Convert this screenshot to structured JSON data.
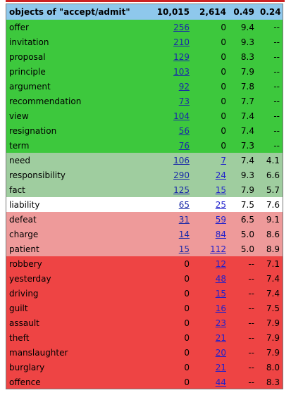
{
  "header": {
    "word": "objects of \"accept/admit\"",
    "col_a": "10,015",
    "col_b": "2,614",
    "col_c": "0.49",
    "col_d": "0.24"
  },
  "colors": {
    "header": "#8ec8ec",
    "green": "#3dc83d",
    "light_green": "#9fcd9f",
    "white": "#ffffff",
    "pink": "#ee9a9a",
    "red": "#ee4444",
    "link": "#1a2aa8",
    "top_strip": "#cc2222"
  },
  "rows": [
    {
      "word": "offer",
      "a": "256",
      "b": "0",
      "c": "9.4",
      "d": "--",
      "band": "green",
      "a_link": true,
      "b_link": false
    },
    {
      "word": "invitation",
      "a": "210",
      "b": "0",
      "c": "9.3",
      "d": "--",
      "band": "green",
      "a_link": true,
      "b_link": false
    },
    {
      "word": "proposal",
      "a": "129",
      "b": "0",
      "c": "8.3",
      "d": "--",
      "band": "green",
      "a_link": true,
      "b_link": false
    },
    {
      "word": "principle",
      "a": "103",
      "b": "0",
      "c": "7.9",
      "d": "--",
      "band": "green",
      "a_link": true,
      "b_link": false
    },
    {
      "word": "argument",
      "a": "92",
      "b": "0",
      "c": "7.8",
      "d": "--",
      "band": "green",
      "a_link": true,
      "b_link": false
    },
    {
      "word": "recommendation",
      "a": "73",
      "b": "0",
      "c": "7.7",
      "d": "--",
      "band": "green",
      "a_link": true,
      "b_link": false
    },
    {
      "word": "view",
      "a": "104",
      "b": "0",
      "c": "7.4",
      "d": "--",
      "band": "green",
      "a_link": true,
      "b_link": false
    },
    {
      "word": "resignation",
      "a": "56",
      "b": "0",
      "c": "7.4",
      "d": "--",
      "band": "green",
      "a_link": true,
      "b_link": false
    },
    {
      "word": "term",
      "a": "76",
      "b": "0",
      "c": "7.3",
      "d": "--",
      "band": "green",
      "a_link": true,
      "b_link": false
    },
    {
      "word": "need",
      "a": "106",
      "b": "7",
      "c": "7.4",
      "d": "4.1",
      "band": "light",
      "a_link": true,
      "b_link": true
    },
    {
      "word": "responsibility",
      "a": "290",
      "b": "24",
      "c": "9.3",
      "d": "6.6",
      "band": "light",
      "a_link": true,
      "b_link": true
    },
    {
      "word": "fact",
      "a": "125",
      "b": "15",
      "c": "7.9",
      "d": "5.7",
      "band": "light",
      "a_link": true,
      "b_link": true
    },
    {
      "word": "liability",
      "a": "65",
      "b": "25",
      "c": "7.5",
      "d": "7.6",
      "band": "white",
      "a_link": true,
      "b_link": true
    },
    {
      "word": "defeat",
      "a": "31",
      "b": "59",
      "c": "6.5",
      "d": "9.1",
      "band": "pink",
      "a_link": true,
      "b_link": true
    },
    {
      "word": "charge",
      "a": "14",
      "b": "84",
      "c": "5.0",
      "d": "8.6",
      "band": "pink",
      "a_link": true,
      "b_link": true
    },
    {
      "word": "patient",
      "a": "15",
      "b": "112",
      "c": "5.0",
      "d": "8.9",
      "band": "pink",
      "a_link": true,
      "b_link": true
    },
    {
      "word": "robbery",
      "a": "0",
      "b": "12",
      "c": "--",
      "d": "7.1",
      "band": "red",
      "a_link": false,
      "b_link": true
    },
    {
      "word": "yesterday",
      "a": "0",
      "b": "48",
      "c": "--",
      "d": "7.4",
      "band": "red",
      "a_link": false,
      "b_link": true
    },
    {
      "word": "driving",
      "a": "0",
      "b": "15",
      "c": "--",
      "d": "7.4",
      "band": "red",
      "a_link": false,
      "b_link": true
    },
    {
      "word": "guilt",
      "a": "0",
      "b": "16",
      "c": "--",
      "d": "7.5",
      "band": "red",
      "a_link": false,
      "b_link": true
    },
    {
      "word": "assault",
      "a": "0",
      "b": "23",
      "c": "--",
      "d": "7.9",
      "band": "red",
      "a_link": false,
      "b_link": true
    },
    {
      "word": "theft",
      "a": "0",
      "b": "21",
      "c": "--",
      "d": "7.9",
      "band": "red",
      "a_link": false,
      "b_link": true
    },
    {
      "word": "manslaughter",
      "a": "0",
      "b": "20",
      "c": "--",
      "d": "7.9",
      "band": "red",
      "a_link": false,
      "b_link": true
    },
    {
      "word": "burglary",
      "a": "0",
      "b": "21",
      "c": "--",
      "d": "8.0",
      "band": "red",
      "a_link": false,
      "b_link": true
    },
    {
      "word": "offence",
      "a": "0",
      "b": "44",
      "c": "--",
      "d": "8.3",
      "band": "red",
      "a_link": false,
      "b_link": true
    }
  ]
}
